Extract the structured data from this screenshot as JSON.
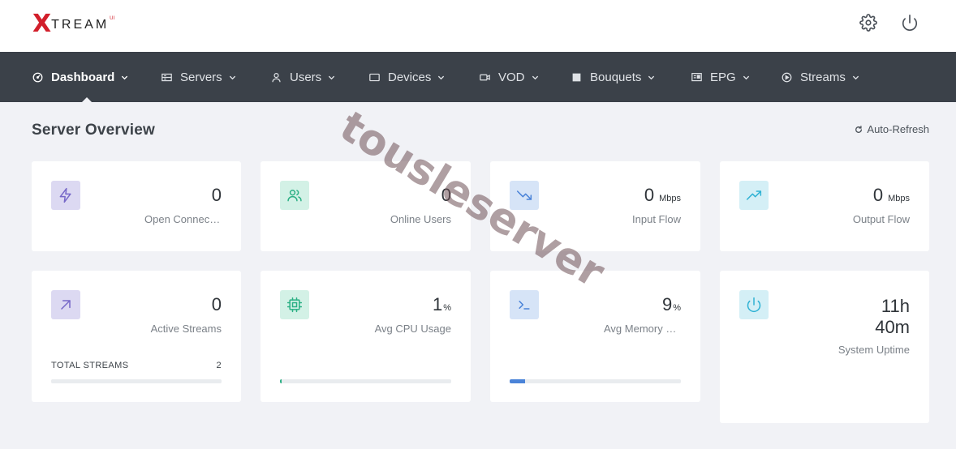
{
  "brand": {
    "logo_x": "X",
    "logo_rest": "TREAM",
    "logo_sup": "UI"
  },
  "header_icons": [
    "gear-icon",
    "power-icon"
  ],
  "nav": {
    "items": [
      {
        "label": "Dashboard",
        "icon": "dashboard-icon"
      },
      {
        "label": "Servers",
        "icon": "server-icon"
      },
      {
        "label": "Users",
        "icon": "user-icon"
      },
      {
        "label": "Devices",
        "icon": "device-icon"
      },
      {
        "label": "VOD",
        "icon": "video-icon"
      },
      {
        "label": "Bouquets",
        "icon": "bouquet-icon"
      },
      {
        "label": "EPG",
        "icon": "epg-icon"
      },
      {
        "label": "Streams",
        "icon": "play-icon"
      }
    ],
    "active_index": 0
  },
  "page": {
    "title": "Server Overview",
    "refresh_label": "Auto-Refresh"
  },
  "cards": [
    {
      "value": "0",
      "unit": "",
      "label": "Open Connections",
      "icon": "bolt-icon",
      "icon_bg": "#dcd9f2",
      "icon_color": "#7668c8"
    },
    {
      "value": "0",
      "unit": "",
      "label": "Online Users",
      "icon": "users-icon",
      "icon_bg": "#d3f1e6",
      "icon_color": "#2bb084"
    },
    {
      "value": "0",
      "unit": "Mbps",
      "label": "Input Flow",
      "icon": "trending-down-icon",
      "icon_bg": "#d6e4f7",
      "icon_color": "#4a83d8"
    },
    {
      "value": "0",
      "unit": "Mbps",
      "label": "Output Flow",
      "icon": "trending-up-icon",
      "icon_bg": "#d4eff6",
      "icon_color": "#2fb2d4"
    },
    {
      "value": "0",
      "unit": "",
      "label": "Active Streams",
      "icon": "arrow-up-right-icon",
      "icon_bg": "#dcd9f2",
      "icon_color": "#7668c8",
      "sub_label": "TOTAL STREAMS",
      "sub_value": "2"
    },
    {
      "value": "1",
      "unit": "%",
      "label": "Avg CPU Usage",
      "icon": "cpu-icon",
      "icon_bg": "#d3f1e6",
      "icon_color": "#2bb084",
      "progress": 0.01,
      "progress_color": "#2bb084"
    },
    {
      "value": "9",
      "unit": "%",
      "label": "Avg Memory Usage",
      "icon": "terminal-icon",
      "icon_bg": "#d6e4f7",
      "icon_color": "#4a83d8",
      "progress": 0.09,
      "progress_color": "#4a83d8"
    },
    {
      "value_line1": "11h",
      "value_line2": "40m",
      "label": "System Uptime",
      "icon": "power-icon",
      "icon_bg": "#d4eff6",
      "icon_color": "#2fb2d4"
    }
  ],
  "watermark": "tousleserver"
}
